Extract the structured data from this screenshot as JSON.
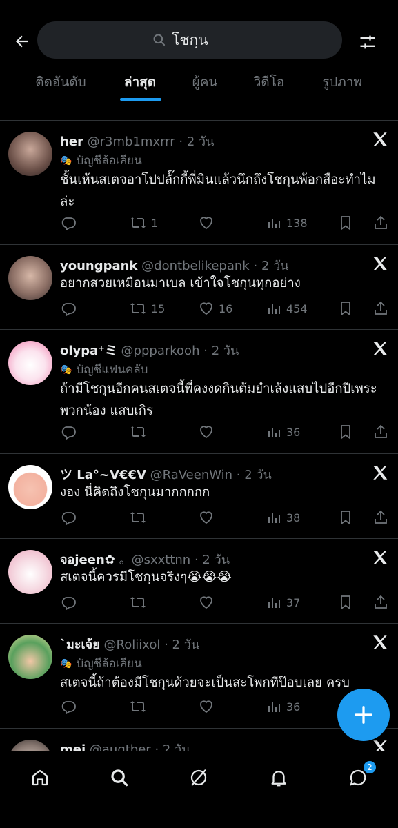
{
  "search": {
    "value": "โชกุน"
  },
  "tabs": [
    {
      "label": "ติดอันดับ"
    },
    {
      "label": "ล่าสุด"
    },
    {
      "label": "ผู้คน"
    },
    {
      "label": "วิดีโอ"
    },
    {
      "label": "รูปภาพ"
    }
  ],
  "active_tab": "ล่าสุด",
  "colors": {
    "accent": "#1d9bf0",
    "background": "#000000",
    "muted": "#71767b",
    "text": "#e7e9ea"
  },
  "tweets": [
    {
      "name": "her",
      "handle": "@r3mb1mxrrr",
      "time": "2 วัน",
      "label": "บัญชีล้อเลียน",
      "text": "ชั้นเห้นสเตจอาโปปลั๊กกี้พี่มินแล้วนึกถึงโชกุนพ้อกสือะทำไมล่ะ",
      "retweets": "1",
      "likes": "",
      "views": "138"
    },
    {
      "name": "youngpank",
      "handle": "@dontbelikepank",
      "time": "2 วัน",
      "label": "",
      "text": "อยากสวยเหมือนมาเบล เข้าใจโชกุนทุกอย่าง",
      "retweets": "15",
      "likes": "16",
      "views": "454"
    },
    {
      "name": "olypa⁺ミ",
      "handle": "@ppparkooh",
      "time": "2 วัน",
      "label": "บัญชีแฟนคลับ",
      "text": "ถ้ามีโชกุนอีกคนสเตจนี้พี่คงงดกินต้มยำเล้งแสบไปอีกปีเพระพวกน้อง แสบเกิร",
      "retweets": "",
      "likes": "",
      "views": "36"
    },
    {
      "name": "ツ La°~V€€V",
      "handle": "@RaVeenWin",
      "time": "2 วัน",
      "label": "",
      "text": "งอง นี่คิดถึงโชกุนมากกกกก",
      "retweets": "",
      "likes": "",
      "views": "38"
    },
    {
      "name": "จอjeen✿",
      "handle": "。@sxxttnn",
      "time": "2 วัน",
      "label": "",
      "text": "สเตจนี้ควรมีโชกุนจริงๆ😭😭😭",
      "retweets": "",
      "likes": "",
      "views": "37"
    },
    {
      "name": "`มะเจ้ย",
      "handle": "@Roliixol",
      "time": "2 วัน",
      "label": "บัญชีล้อเลียน",
      "text": "สเตจนี้ถ้าต้องมีโชกุนด้วยจะเป็นสะโพกทีป๊อบเลย ครบ",
      "retweets": "",
      "likes": "",
      "views": "36"
    },
    {
      "name": "mei",
      "handle": "@augtber",
      "time": "2 วัน",
      "label": "",
      "text": "",
      "retweets": "",
      "likes": "",
      "views": ""
    }
  ],
  "nav": {
    "messages_badge": "2"
  }
}
